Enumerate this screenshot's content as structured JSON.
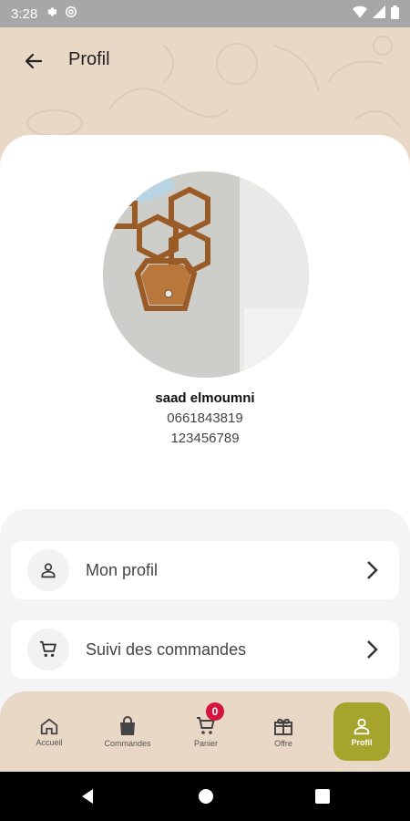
{
  "status_bar": {
    "time": "3:28",
    "icons": [
      "gear-icon",
      "at-icon",
      "wifi-icon",
      "signal-icon",
      "battery-icon"
    ]
  },
  "header": {
    "title": "Profil",
    "back_icon": "arrow-left-icon"
  },
  "profile": {
    "name": "saad elmoumni",
    "phone": "0661843819",
    "code": "123456789"
  },
  "menu": [
    {
      "label": "Mon profil",
      "icon": "person-icon"
    },
    {
      "label": "Suivi des commandes",
      "icon": "cart-icon"
    }
  ],
  "bottom_nav": {
    "items": [
      {
        "label": "Accueil",
        "icon": "home-icon"
      },
      {
        "label": "Commandes",
        "icon": "bag-icon"
      },
      {
        "label": "Panier",
        "icon": "cart-icon",
        "badge": "0"
      },
      {
        "label": "Offre",
        "icon": "gift-icon"
      },
      {
        "label": "Profil",
        "icon": "person-icon",
        "active": true
      }
    ]
  },
  "colors": {
    "accent": "#a7a42e",
    "header_bg": "#ead8c7",
    "badge": "#d2153e",
    "status_bar": "#a7a7a7"
  }
}
